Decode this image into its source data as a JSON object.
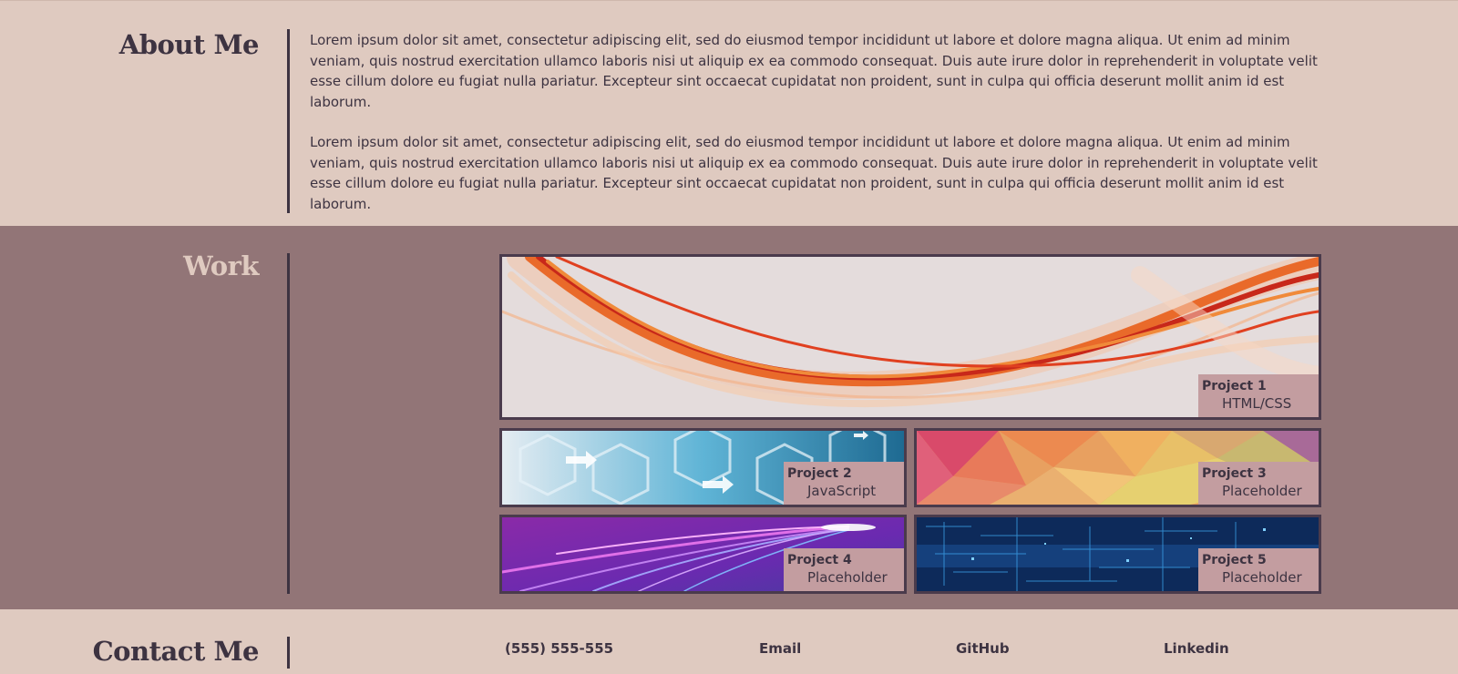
{
  "about": {
    "heading": "About Me",
    "paragraphs": [
      "Lorem ipsum dolor sit amet, consectetur adipiscing elit, sed do eiusmod tempor incididunt ut labore et dolore magna aliqua. Ut enim ad minim veniam, quis nostrud exercitation ullamco laboris nisi ut aliquip ex ea commodo consequat. Duis aute irure dolor in reprehenderit in voluptate velit esse cillum dolore eu fugiat nulla pariatur. Excepteur sint occaecat cupidatat non proident, sunt in culpa qui officia deserunt mollit anim id est laborum.",
      "Lorem ipsum dolor sit amet, consectetur adipiscing elit, sed do eiusmod tempor incididunt ut labore et dolore magna aliqua. Ut enim ad minim veniam, quis nostrud exercitation ullamco laboris nisi ut aliquip ex ea commodo consequat. Duis aute irure dolor in reprehenderit in voluptate velit esse cillum dolore eu fugiat nulla pariatur. Excepteur sint occaecat cupidatat non proident, sunt in culpa qui officia deserunt mollit anim id est laborum."
    ]
  },
  "work": {
    "heading": "Work",
    "projects": [
      {
        "name": "Project 1",
        "desc": "HTML/CSS",
        "image": "red-orange-waves"
      },
      {
        "name": "Project 2",
        "desc": "JavaScript",
        "image": "blue-hexagon-tech"
      },
      {
        "name": "Project 3",
        "desc": "Placeholder",
        "image": "colorful-low-poly"
      },
      {
        "name": "Project 4",
        "desc": "Placeholder",
        "image": "purple-light-streaks"
      },
      {
        "name": "Project 5",
        "desc": "Placeholder",
        "image": "blue-circuit-data"
      }
    ]
  },
  "contact": {
    "heading": "Contact Me",
    "phone": "(555) 555-555",
    "email": "Email",
    "github": "GitHub",
    "linkedin": "Linkedin"
  },
  "colors": {
    "background_light": "#dfcac0",
    "background_work": "#927577",
    "text_dark": "#3d3341",
    "label_bg": "#c39da0"
  }
}
